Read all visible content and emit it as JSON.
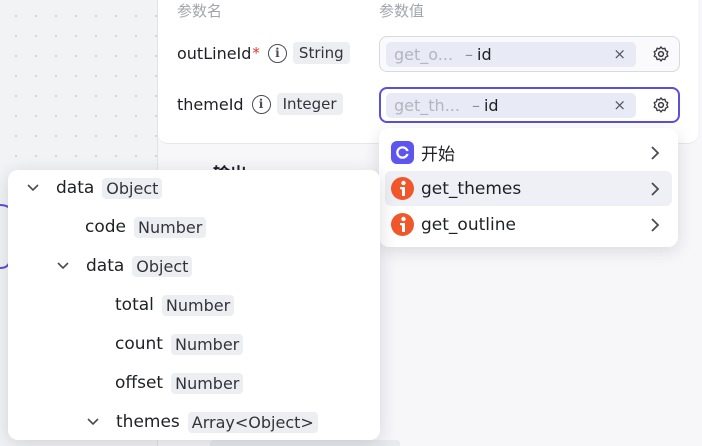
{
  "params": {
    "header_name": "参数名",
    "header_value": "参数值",
    "rows": [
      {
        "name": "outLineId",
        "required_mark": "*",
        "type": "String",
        "var_source": "get_o...",
        "var_sep": "–",
        "var_field": "id",
        "clear_icon": "×"
      },
      {
        "name": "themeId",
        "type": "Integer",
        "var_source": "get_th...",
        "var_sep": "–",
        "var_field": "id",
        "clear_icon": "×"
      }
    ]
  },
  "output": {
    "title": "输出"
  },
  "dropdown": {
    "items": [
      {
        "label": "开始",
        "icon": "start-node-icon"
      },
      {
        "label": "get_themes",
        "icon": "api-plugin-icon"
      },
      {
        "label": "get_outline",
        "icon": "api-plugin-icon"
      }
    ]
  },
  "tree": {
    "nodes": [
      {
        "name": "data",
        "type": "Object",
        "expandable": true
      },
      {
        "name": "code",
        "type": "Number",
        "expandable": false
      },
      {
        "name": "data",
        "type": "Object",
        "expandable": true
      },
      {
        "name": "total",
        "type": "Number",
        "expandable": false
      },
      {
        "name": "count",
        "type": "Number",
        "expandable": false
      },
      {
        "name": "offset",
        "type": "Number",
        "expandable": false
      },
      {
        "name": "themes",
        "type": "Array<Object>",
        "expandable": true
      }
    ]
  },
  "colors": {
    "accent": "#5b50d6",
    "start_icon": "#5c55f0",
    "api_icon": "#f0582c",
    "required": "#e0342e"
  }
}
